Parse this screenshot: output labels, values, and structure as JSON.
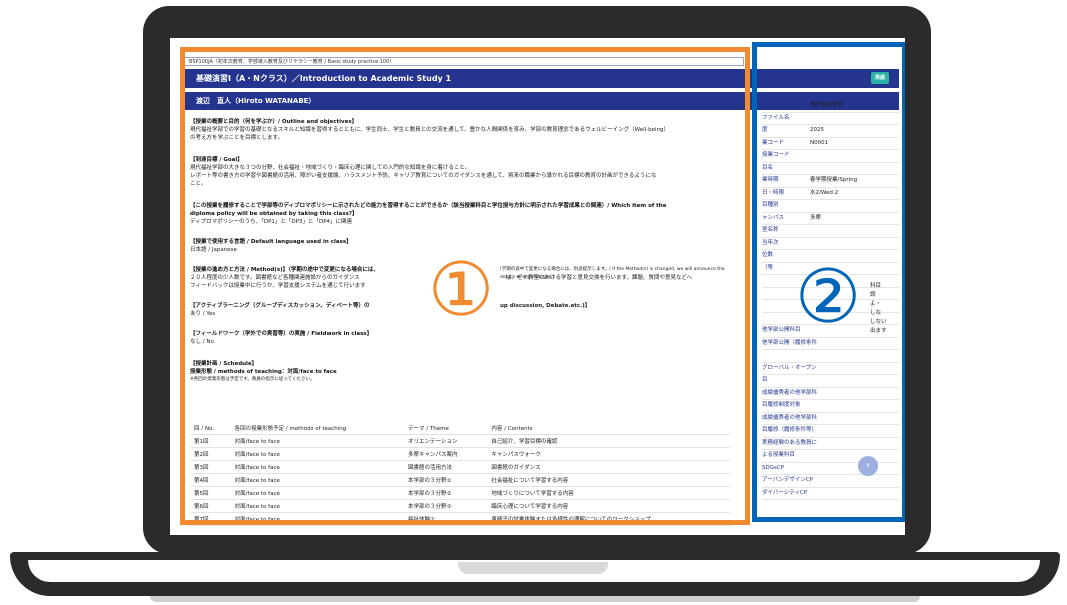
{
  "breadcrumb": "BSP100JA（初年次教育、学部導入教育及びリテラシー教育 / Basic study practice 100）",
  "title": "基礎演習Ⅰ（A・Nクラス）／Introduction to Academic Study 1",
  "badge": "英語",
  "instructor": "渡辺　直人（Hiroto WATANABE）",
  "sections": [
    {
      "heading": "【授業の概要と目的（何を学ぶか）/ Outline and objectives】",
      "lines": [
        "現代福祉学部での学習の基礎となるスキルと知識を習得するとともに、学生同士、学生と教員との交流を通して、豊かな人間関係を育み、学部の教育理念であるウェルビーイング（Well-being）",
        "の考え方を学ぶことを目標とします。"
      ]
    },
    {
      "heading": "【到達目標 / Goal】",
      "lines": [
        "現代福祉学部の大きな３つの分野、社会福祉・地域づくり・臨床心理に関しての入門的な知識を身に着けること。",
        "レポート等の書き方の学習や図書館の活用、障がい者支援論、ハラスメント予防、キャリア教育についてのガイダンスを通して、将来の職業から導かれる目標の教育の計画ができるようにな",
        "こと。"
      ]
    },
    {
      "heading": "【この授業を履修することで学部等のディプロマポリシーに示されたどの能力を習得することができるか（該当授業科目と学位授与方針に明示された学習成果との関連）/ Which item of the",
      "lines": [
        "diploma policy will be obtained by taking this class?】",
        "ディプロマポリシーのうち、「DP1」と「DP3」と「DP4」に関連"
      ]
    },
    {
      "heading": "【授業で使用する言語 / Default language used in class】",
      "lines": [
        "日本語 / Japanese"
      ]
    },
    {
      "heading": "【授業の進め方と方法 / Method(s)】（学期の途中で変更になる場合には、",
      "lines": [
        "２０人程度の少人数です。図書館など各種関連施設からのガイダンス",
        "フィードバックは授業中に行うか、学習支援システムを通じて行います"
      ]
    },
    {
      "heading": "【アクティブラーニング（グループディスカッション、ディベート等）の",
      "lines": [
        "あり / Yes"
      ]
    },
    {
      "heading": "【フィールドワーク（学外での実習等）の実施 / Fieldwork in class】",
      "lines": [
        "なし / No"
      ]
    },
    {
      "heading": "【授業計画 / Schedule】",
      "lines": [
        "授業形態 / methods of teaching：対面/face to face",
        "※各回の授業形態は予定です。教員の指示に従ってください。"
      ]
    }
  ],
  "method_note": "(学期の途中で変更になる場合には、別途提示します。/ If the Method(s) is changed, we will announce the details of any changes.)",
  "method_tail1": "は、ゼミ教室における学習と意見交換を行います。課題、質問や意見などへ",
  "active_tail": "up discussion, Debate.etc.)】",
  "schedule": {
    "headers": [
      "回 / No.",
      "各回の授業形態予定 / methods of teaching",
      "テーマ / Theme",
      "内容 / Contents"
    ],
    "rows": [
      [
        "第1回",
        "対面/face to face",
        "オリエンテーション",
        "自己紹介、学習目標の確認"
      ],
      [
        "第2回",
        "対面/face to face",
        "多摩キャンパス案内",
        "キャンパスウォーク"
      ],
      [
        "第3回",
        "対面/face to face",
        "図書館の活用方法",
        "図書館のガイダンス"
      ],
      [
        "第4回",
        "対面/face to face",
        "本学部の３分野①",
        "社会福祉について学習する内容"
      ],
      [
        "第5回",
        "対面/face to face",
        "本学部の３分野②",
        "地域づくりについて学習する内容"
      ],
      [
        "第6回",
        "対面/face to face",
        "本学部の３分野③",
        "臨床心理について学習する内容"
      ],
      [
        "第7回",
        "対面/face to face",
        "福祉体験①",
        "車椅子の試乗体験または多様性の理解についてのワークショップ"
      ]
    ]
  },
  "side_rows": [
    {
      "label": "学部・研究科",
      "value": "現代福祉学部"
    },
    {
      "label": "ファイル名",
      "value": ""
    },
    {
      "label": "度",
      "value": "2025"
    },
    {
      "label": "業コード",
      "value": "N0001"
    },
    {
      "label": "授業コード",
      "value": ""
    },
    {
      "label": "目名",
      "value": ""
    },
    {
      "label": "業時期",
      "value": "春学期授業/Spring"
    },
    {
      "label": "日・時限",
      "value": "水2/Wed.2"
    },
    {
      "label": "目種別",
      "value": ""
    },
    {
      "label": "ャンパス",
      "value": "多摩"
    },
    {
      "label": "室名称",
      "value": ""
    },
    {
      "label": "当年次",
      "value": ""
    },
    {
      "label": "位数",
      "value": ""
    },
    {
      "label": "（等",
      "value": ""
    },
    {
      "label": "",
      "value": ""
    },
    {
      "label": "",
      "value": ""
    },
    {
      "label": "",
      "value": ""
    },
    {
      "label": "",
      "value": ""
    },
    {
      "label": "他学部公開科目",
      "value": ""
    },
    {
      "label": "他学部公開（履修条件",
      "value": ""
    },
    {
      "label": "",
      "value": ""
    },
    {
      "label": "グローバル・オープン",
      "value": ""
    },
    {
      "label": "目",
      "value": ""
    },
    {
      "label": "成績優秀者の他学部科",
      "value": ""
    },
    {
      "label": "目履修制度対象",
      "value": ""
    },
    {
      "label": "成績優秀者の他学部科",
      "value": ""
    },
    {
      "label": "目履修（履修条件等）",
      "value": ""
    },
    {
      "label": "実務経験のある教員に",
      "value": ""
    },
    {
      "label": "よる授業科目",
      "value": ""
    },
    {
      "label": "SDGsCP",
      "value": ""
    },
    {
      "label": "アーバンデザインCP",
      "value": ""
    },
    {
      "label": "ダイバーシティCP",
      "value": ""
    }
  ],
  "side_partial": [
    "科目",
    "調",
    "よ・",
    "しな",
    "しない",
    "出ます"
  ],
  "annotations": {
    "one": "①",
    "two": "②"
  },
  "nav": "›",
  "colors": {
    "orange": "#f28a30",
    "blue": "#0065b8",
    "navy": "#24348f"
  }
}
